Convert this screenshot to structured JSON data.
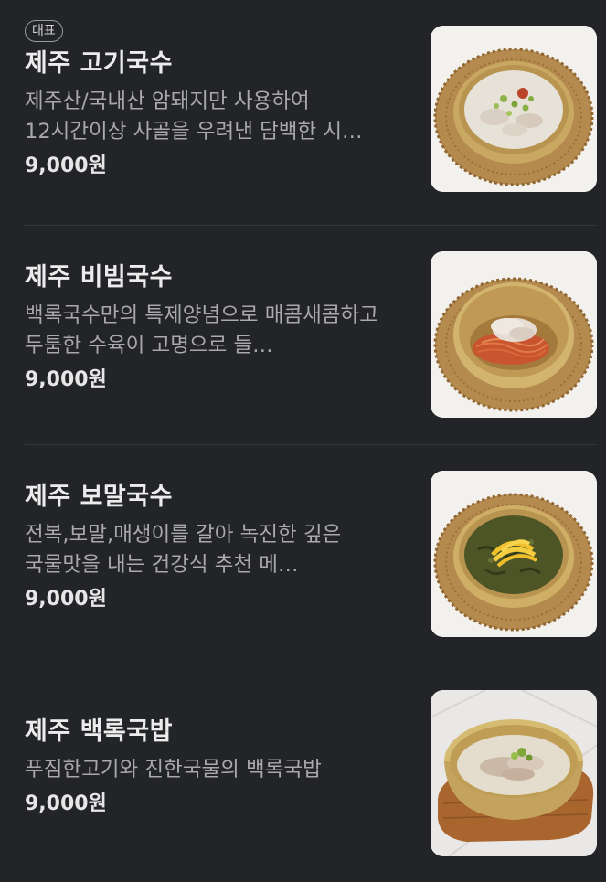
{
  "menu": {
    "items": [
      {
        "badge": "대표",
        "name": "제주 고기국수",
        "description": "제주산/국내산 암돼지만 사용하여 12시간이상 사골을 우려낸 담백한 시…",
        "price": "9,000원",
        "photo_icon": "pork-noodle-soup-photo"
      },
      {
        "name": "제주 비빔국수",
        "description": "백록국수만의 특제양념으로 매콤새콤하고 두툼한 수육이 고명으로 들…",
        "price": "9,000원",
        "photo_icon": "spicy-mixed-noodle-photo"
      },
      {
        "name": "제주 보말국수",
        "description": "전복,보말,매생이를 갈아 녹진한 깊은 국물맛을 내는 건강식 추천 메…",
        "price": "9,000원",
        "photo_icon": "seaweed-noodle-soup-photo"
      },
      {
        "name": "제주 백록국밥",
        "description": "푸짐한고기와 진한국물의 백록국밥",
        "price": "9,000원",
        "photo_icon": "pork-rice-soup-photo"
      }
    ]
  }
}
